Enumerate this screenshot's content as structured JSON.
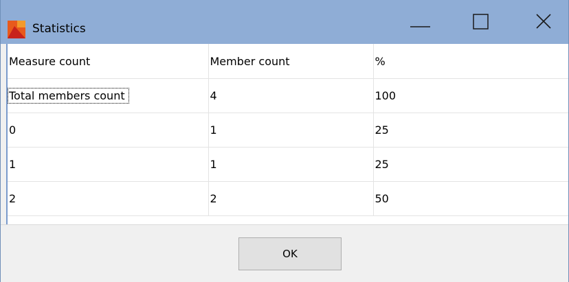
{
  "window": {
    "title": "Statistics",
    "app_icon": "chart-app-icon",
    "controls": {
      "minimize_icon": "minimize-icon",
      "maximize_icon": "maximize-icon",
      "close_icon": "close-icon"
    }
  },
  "table": {
    "headers": [
      "Measure count",
      "Member count",
      "%"
    ],
    "rows": [
      [
        "Total members count",
        "4",
        "100"
      ],
      [
        "0",
        "1",
        "25"
      ],
      [
        "1",
        "1",
        "25"
      ],
      [
        "2",
        "2",
        "50"
      ]
    ]
  },
  "footer": {
    "ok_label": "OK"
  },
  "colors": {
    "titlebar": "#8fadd6",
    "window_border": "#6f8fb8",
    "grid_lines": "#e3e3e3",
    "button_face": "#e1e1e1"
  }
}
